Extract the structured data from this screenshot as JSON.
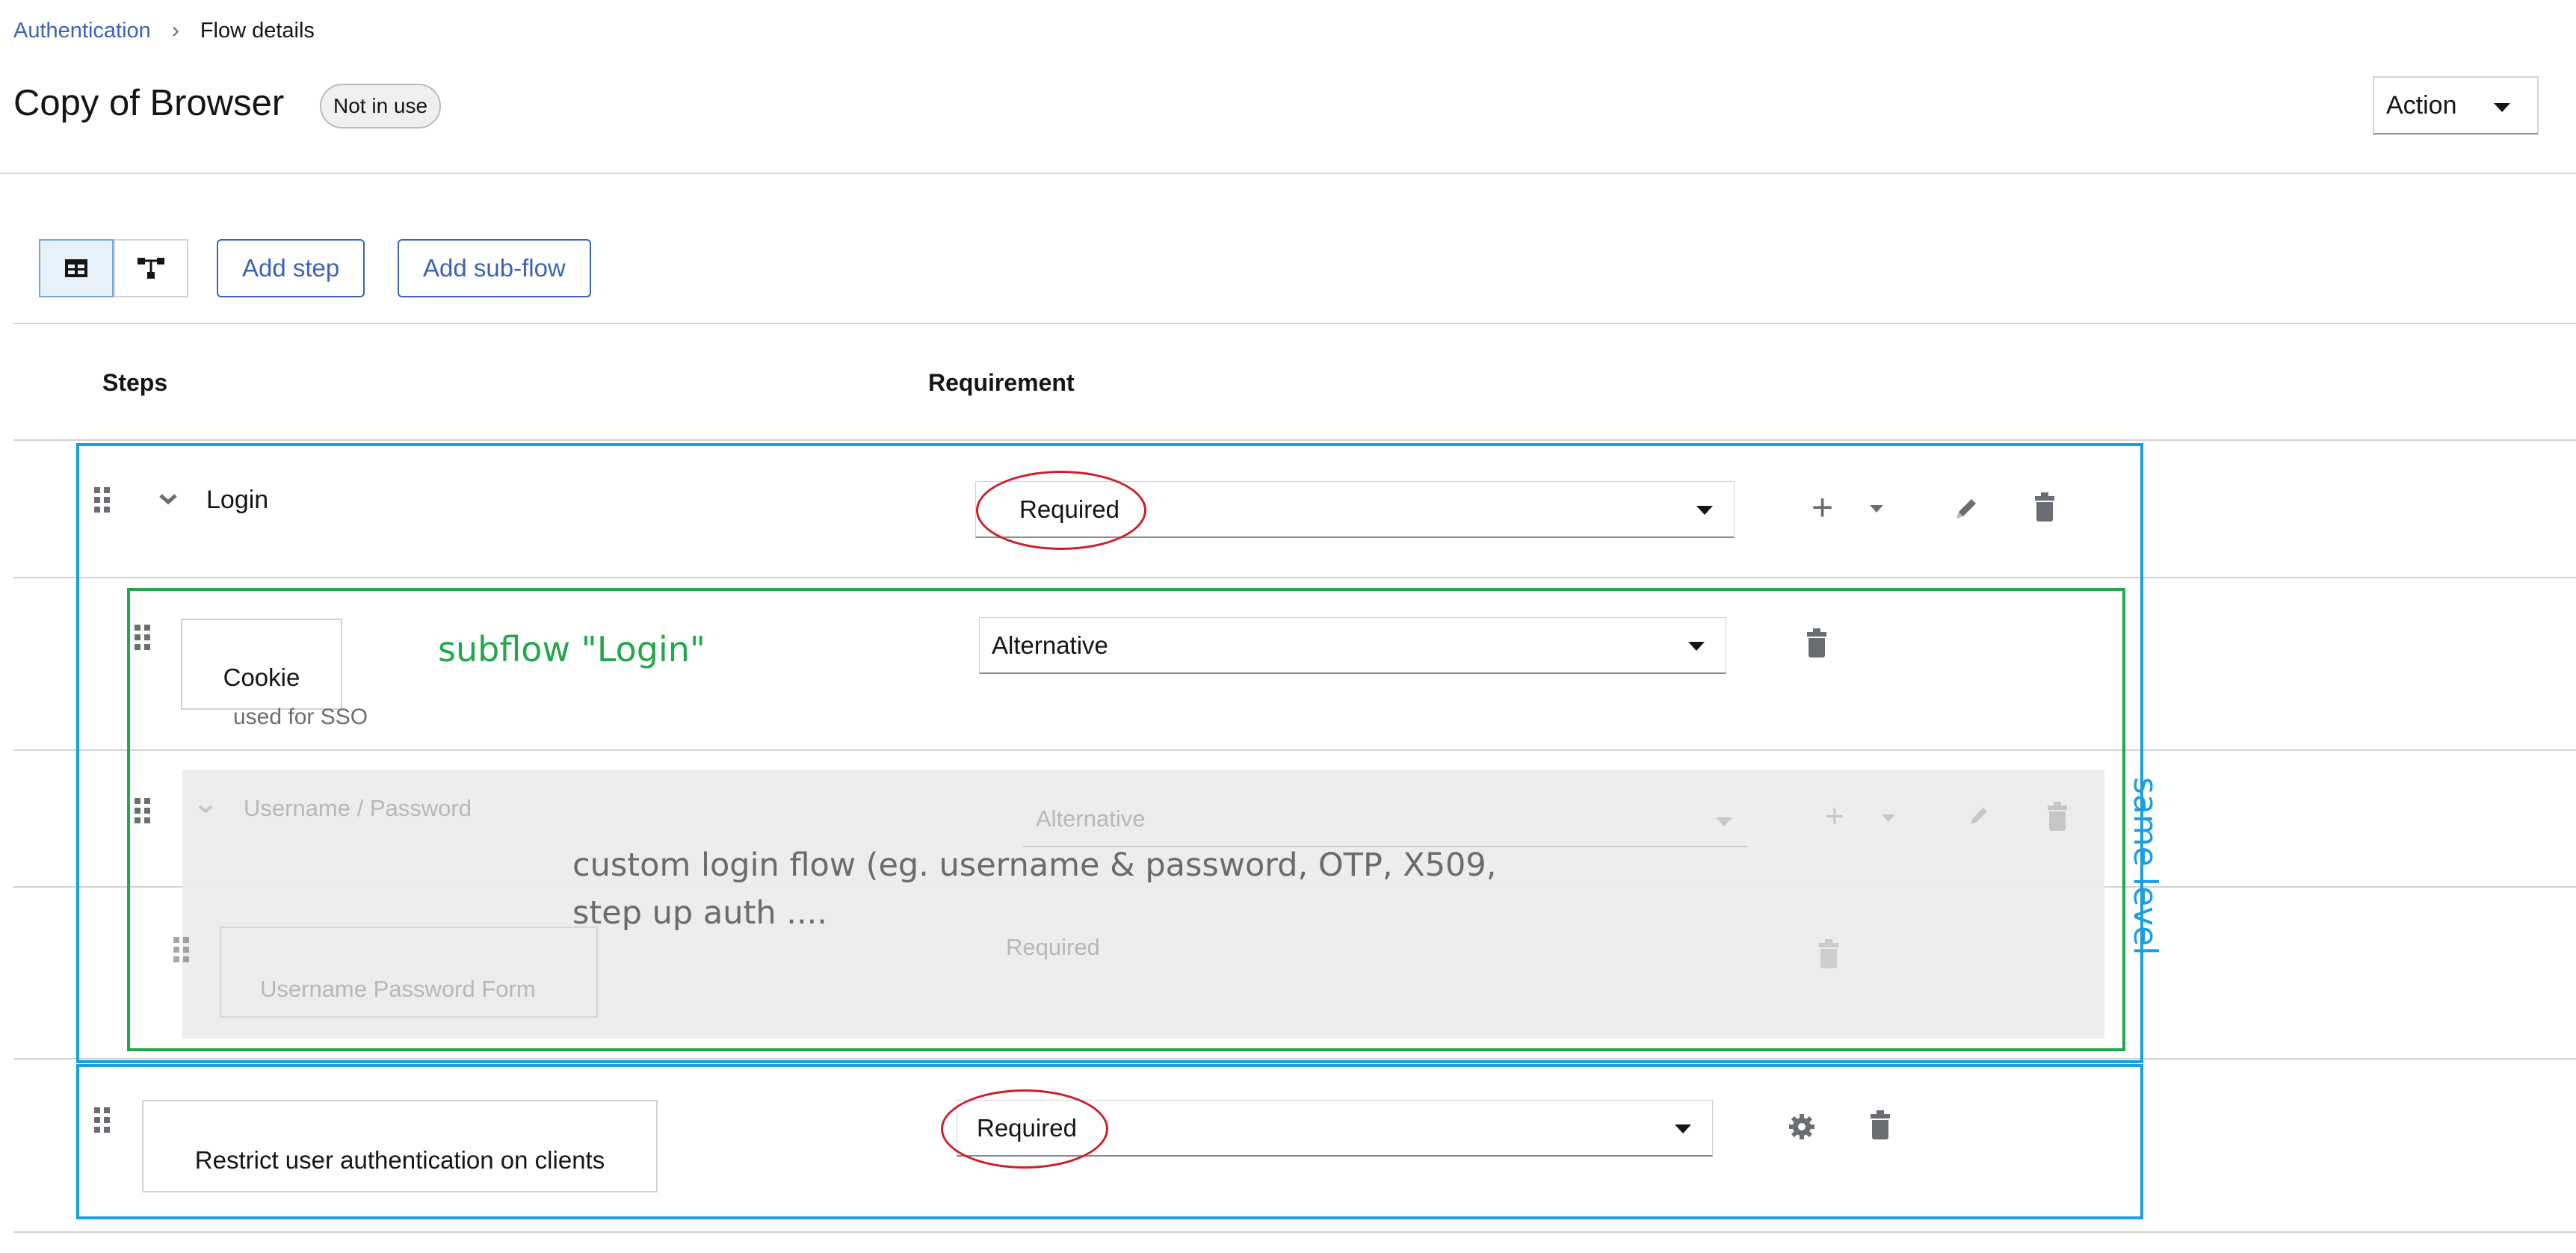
{
  "breadcrumb": {
    "root": "Authentication",
    "separator": "›",
    "current": "Flow details"
  },
  "header": {
    "title": "Copy of Browser",
    "badge": "Not in use",
    "action_label": "Action"
  },
  "toolbar": {
    "add_step": "Add step",
    "add_subflow": "Add sub-flow"
  },
  "table": {
    "col_steps": "Steps",
    "col_requirement": "Requirement",
    "rows": [
      {
        "name": "Login",
        "requirement": "Required"
      },
      {
        "name": "Cookie",
        "description": "used for SSO",
        "requirement": "Alternative"
      },
      {
        "name": "Username / Password",
        "requirement": "Alternative"
      },
      {
        "name": "Username Password Form",
        "requirement": "Required"
      },
      {
        "name": "Restrict user authentication on clients",
        "requirement": "Required"
      }
    ]
  },
  "annotations": {
    "subflow_label": "subflow \"Login\"",
    "same_level": "same level",
    "custom_line1": "custom login flow (eg. username & password, OTP, X509,",
    "custom_line2": "step up auth ...."
  },
  "colors": {
    "link": "#3c63b8",
    "frame_blue": "#1a9fe0",
    "frame_green": "#22a84a",
    "ellipse_red": "#cc1f2b"
  }
}
